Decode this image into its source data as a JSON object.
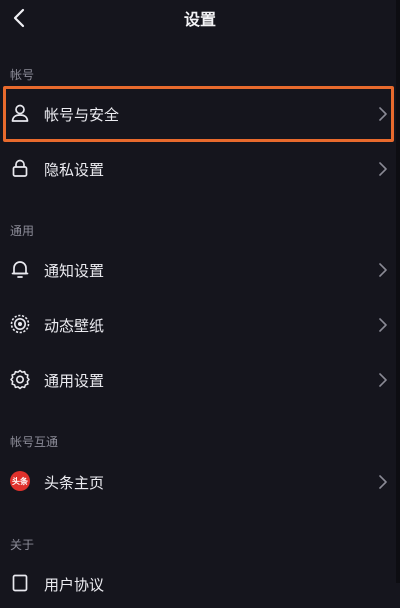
{
  "header": {
    "title": "设置",
    "back_icon": "chevron-left-icon"
  },
  "sections": [
    {
      "label": "帐号"
    },
    {
      "label": "通用"
    },
    {
      "label": "帐号互通"
    },
    {
      "label": "关于"
    }
  ],
  "rows": [
    {
      "label": "帐号与安全",
      "icon": "user-icon"
    },
    {
      "label": "隐私设置",
      "icon": "lock-icon"
    },
    {
      "label": "通知设置",
      "icon": "bell-icon"
    },
    {
      "label": "动态壁纸",
      "icon": "wallpaper-icon"
    },
    {
      "label": "通用设置",
      "icon": "gear-icon"
    },
    {
      "label": "头条主页",
      "icon": "toutiao-icon",
      "badge_text": "头条"
    },
    {
      "label": "用户协议",
      "icon": "document-icon"
    }
  ],
  "colors": {
    "background": "#15151d",
    "highlight": "#e86a2d",
    "badge": "#e0312c"
  }
}
